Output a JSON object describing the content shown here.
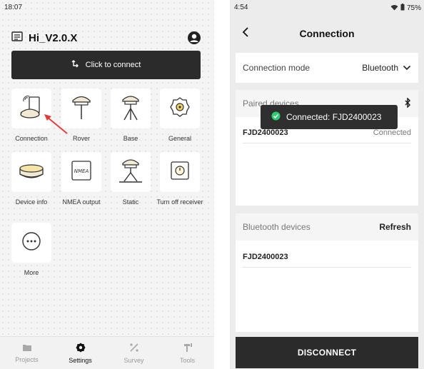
{
  "left": {
    "status_time": "18:07",
    "app_title": "Hi_V2.0.X",
    "connect_label": "Click to connect",
    "tiles": [
      {
        "label": "Connection",
        "icon": "receiver-connection-icon"
      },
      {
        "label": "Rover",
        "icon": "rover-icon"
      },
      {
        "label": "Base",
        "icon": "base-tripod-icon"
      },
      {
        "label": "General",
        "icon": "gear-icon"
      },
      {
        "label": "Device info",
        "icon": "device-info-icon"
      },
      {
        "label": "NMEA output",
        "icon": "nmea-icon"
      },
      {
        "label": "Static",
        "icon": "static-icon"
      },
      {
        "label": "Turn off receiver",
        "icon": "power-icon"
      },
      {
        "label": "More",
        "icon": "more-icon"
      }
    ],
    "nav": [
      {
        "label": "Projects",
        "icon": "folder-icon"
      },
      {
        "label": "Settings",
        "icon": "settings-icon"
      },
      {
        "label": "Survey",
        "icon": "survey-icon"
      },
      {
        "label": "Tools",
        "icon": "tools-icon"
      }
    ],
    "active_nav": "Settings",
    "colors": {
      "dark": "#2b2b2b",
      "annotation_arrow": "#e53935"
    }
  },
  "right": {
    "status_time": "4:54",
    "battery": "75%",
    "title": "Connection",
    "mode_label": "Connection mode",
    "mode_value": "Bluetooth",
    "paired_header": "Paired devices",
    "paired_devices": [
      {
        "name": "FJD2400023",
        "status": "Connected"
      }
    ],
    "toast": "Connected: FJD2400023",
    "bt_header": "Bluetooth devices",
    "refresh_label": "Refresh",
    "bt_devices": [
      {
        "name": "FJD2400023"
      }
    ],
    "disconnect_label": "DISCONNECT",
    "colors": {
      "toast_check": "#2ecc71"
    }
  }
}
